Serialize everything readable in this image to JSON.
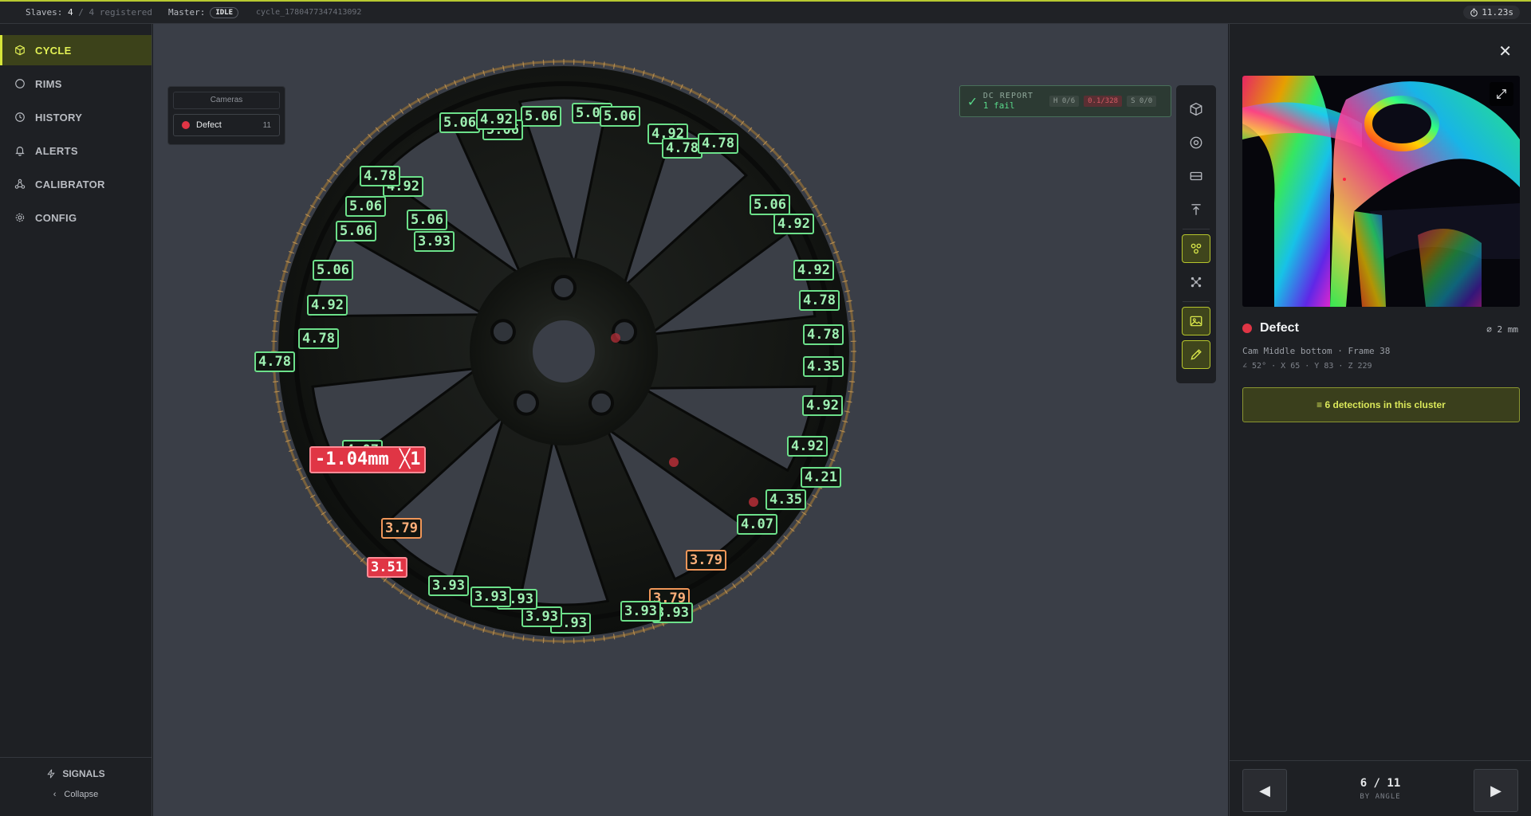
{
  "topbar": {
    "slaves_label": "Slaves:",
    "slaves_count": "4",
    "slaves_registered": "/ 4 registered",
    "master_label": "Master:",
    "master_status": "IDLE",
    "cycle_id": "cycle_1780477347413092",
    "timer": "11.23s"
  },
  "sidebar": {
    "items": [
      {
        "label": "CYCLE",
        "icon": "cube-icon",
        "active": true
      },
      {
        "label": "RIMS",
        "icon": "circle-icon"
      },
      {
        "label": "HISTORY",
        "icon": "history-icon"
      },
      {
        "label": "ALERTS",
        "icon": "bell-icon"
      },
      {
        "label": "CALIBRATOR",
        "icon": "nodes-icon"
      },
      {
        "label": "CONFIG",
        "icon": "gear-icon"
      }
    ],
    "signals_label": "SIGNALS",
    "collapse_label": "Collapse"
  },
  "cameras": {
    "header": "Cameras",
    "row_label": "Defect",
    "row_count": "11"
  },
  "dc_report": {
    "title": "DC REPORT",
    "status": "1 fail",
    "pill_h": "H 0/6",
    "pill_fail": "0.1/328",
    "pill_s": "S 0/0"
  },
  "wheel_labels": [
    {
      "text": "5.06",
      "color": "green"
    },
    {
      "text": "5.06",
      "color": "green"
    },
    {
      "text": "5.06",
      "color": "green"
    },
    {
      "text": "5.06",
      "color": "green"
    },
    {
      "text": "4.92",
      "color": "green"
    },
    {
      "text": "4.78",
      "color": "green"
    },
    {
      "text": "5.06",
      "color": "green"
    },
    {
      "text": "4.92",
      "color": "green"
    },
    {
      "text": "3.93",
      "color": "green"
    },
    {
      "text": "4.78",
      "color": "green"
    },
    {
      "text": "5.06",
      "color": "green"
    },
    {
      "text": "4.92",
      "color": "green"
    },
    {
      "text": "4.92",
      "color": "green"
    },
    {
      "text": "4.78",
      "color": "green"
    },
    {
      "text": "4.78",
      "color": "green"
    },
    {
      "text": "4.35",
      "color": "green"
    },
    {
      "text": "4.92",
      "color": "green"
    },
    {
      "text": "4.92",
      "color": "green"
    },
    {
      "text": "4.21",
      "color": "green"
    },
    {
      "text": "4.35",
      "color": "green"
    },
    {
      "text": "4.07",
      "color": "green"
    },
    {
      "text": "3.79",
      "color": "orange"
    },
    {
      "text": "3.79",
      "color": "orange"
    },
    {
      "text": "3.93",
      "color": "green"
    },
    {
      "text": "3.93",
      "color": "green"
    },
    {
      "text": "3.93",
      "color": "green"
    },
    {
      "text": "3.93",
      "color": "green"
    },
    {
      "text": "3.93",
      "color": "green"
    },
    {
      "text": "3.93",
      "color": "green"
    },
    {
      "text": "3.93",
      "color": "green"
    },
    {
      "text": "3.51",
      "color": "red"
    },
    {
      "text": "3.79",
      "color": "orange"
    },
    {
      "text": "4.07",
      "color": "green"
    },
    {
      "text": "-1.04mm ╳1",
      "color": "red-big"
    },
    {
      "text": "4.78",
      "color": "green"
    },
    {
      "text": "4.78",
      "color": "green"
    },
    {
      "text": "4.92",
      "color": "green"
    },
    {
      "text": "5.06",
      "color": "green"
    },
    {
      "text": "5.06",
      "color": "green"
    },
    {
      "text": "5.06",
      "color": "green"
    },
    {
      "text": "4.78",
      "color": "green"
    },
    {
      "text": "5.06",
      "color": "green"
    },
    {
      "text": "4.92",
      "color": "green"
    }
  ],
  "detail": {
    "title": "Defect",
    "size": "⌀ 2 mm",
    "camera": "Cam Middle bottom · Frame 38",
    "position": "∠ 52° · X 65 · Y 83 · Z 229",
    "cluster_button": "≡ 6 detections in this cluster",
    "pager": "6 / 11",
    "pager_sub": "BY ANGLE"
  },
  "colors": {
    "accent": "#d6e53a",
    "ok": "#6ce08a",
    "warn": "#f09658",
    "fail": "#e03545"
  }
}
